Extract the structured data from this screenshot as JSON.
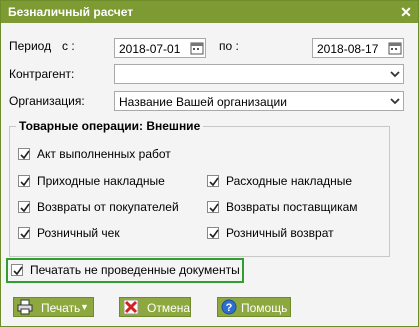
{
  "window": {
    "title": "Безналичный расчет",
    "close_icon": "close-icon"
  },
  "period": {
    "label": "Период",
    "from_label": "с :",
    "to_label": "по :",
    "from_value": "2018-07-01",
    "to_value": "2018-08-17"
  },
  "counterparty": {
    "label": "Контрагент:",
    "value": ""
  },
  "organization": {
    "label": "Организация:",
    "value": "Название Вашей организации"
  },
  "operations": {
    "legend": "Товарные операции: Внешние",
    "items": [
      {
        "label": "Акт выполненных работ",
        "checked": true
      },
      {
        "label": "Приходные накладные",
        "checked": true
      },
      {
        "label": "Расходные накладные",
        "checked": true
      },
      {
        "label": "Возвраты от покупателей",
        "checked": true
      },
      {
        "label": "Возвраты поставщикам",
        "checked": true
      },
      {
        "label": "Розничный чек",
        "checked": true
      },
      {
        "label": "Розничный возврат",
        "checked": true
      }
    ]
  },
  "print_unposted": {
    "label": "Печатать не проведенные документы",
    "checked": true
  },
  "buttons": {
    "print": "Печать",
    "cancel": "Отмена",
    "help": "Помощь"
  },
  "colors": {
    "titlebar": "#7d9b32",
    "button": "#8da83f",
    "highlight": "#2fa02f"
  }
}
